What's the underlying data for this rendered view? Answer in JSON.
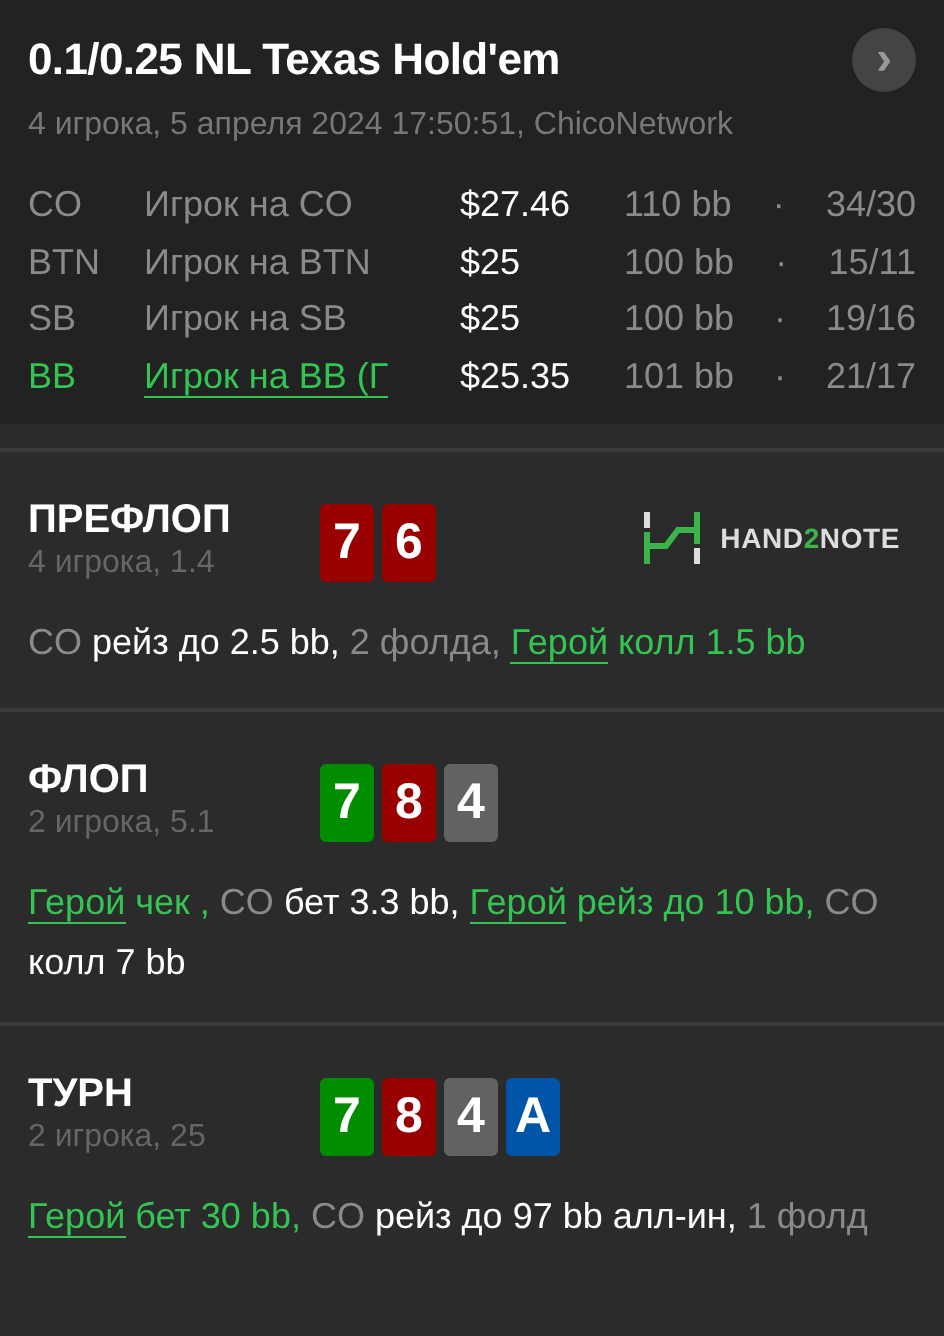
{
  "header": {
    "title": "0.1/0.25 NL Texas Hold'em",
    "subtitle": "4 игрока, 5 апреля 2024 17:50:51, ChicoNetwork",
    "next_button": "›"
  },
  "players": [
    {
      "position": "CO",
      "name": "Игрок на CO",
      "stack": "$27.46",
      "bb": "110 bb",
      "sep": "·",
      "stats": "34/30",
      "hero": false
    },
    {
      "position": "BTN",
      "name": "Игрок на BTN",
      "stack": "$25",
      "bb": "100 bb",
      "sep": "·",
      "stats": "15/11",
      "hero": false
    },
    {
      "position": "SB",
      "name": "Игрок на SB",
      "stack": "$25",
      "bb": "100 bb",
      "sep": "·",
      "stats": "19/16",
      "hero": false
    },
    {
      "position": "BB",
      "name": "Игрок на BB (Г",
      "stack": "$25.35",
      "bb": "101 bb",
      "sep": "·",
      "stats": "21/17",
      "hero": true
    }
  ],
  "streets": [
    {
      "name": "ПРЕФЛОП",
      "info": "4 игрока, 1.4",
      "cards": [
        {
          "rank": "7",
          "color": "#990000"
        },
        {
          "rank": "6",
          "color": "#990000"
        }
      ],
      "logo": [
        "HAND",
        "2",
        "NOTE"
      ],
      "actions": [
        {
          "text": "CO ",
          "kind": "muted"
        },
        {
          "text": "рейз до 2.5 bb,",
          "kind": "plain"
        },
        {
          "text": " 2 фолда, ",
          "kind": "muted"
        },
        {
          "text": "Герой",
          "kind": "link"
        },
        {
          "text": " колл 1.5 bb",
          "kind": "hero"
        }
      ]
    },
    {
      "name": "ФЛОП",
      "info": "2 игрока, 5.1",
      "cards": [
        {
          "rank": "7",
          "color": "#008e00"
        },
        {
          "rank": "8",
          "color": "#990000"
        },
        {
          "rank": "4",
          "color": "#626262"
        }
      ],
      "actions": [
        {
          "text": "Герой",
          "kind": "link"
        },
        {
          "text": " чек ,",
          "kind": "hero"
        },
        {
          "text": " CO ",
          "kind": "muted"
        },
        {
          "text": "бет 3.3 bb, ",
          "kind": "plain"
        },
        {
          "text": "Герой",
          "kind": "link"
        },
        {
          "text": " рейз до 10 bb,",
          "kind": "hero"
        },
        {
          "text": " CO ",
          "kind": "muted"
        },
        {
          "text": "колл 7 bb",
          "kind": "plain"
        }
      ]
    },
    {
      "name": "ТУРН",
      "info": "2 игрока, 25",
      "cards": [
        {
          "rank": "7",
          "color": "#008e00"
        },
        {
          "rank": "8",
          "color": "#990000"
        },
        {
          "rank": "4",
          "color": "#626262"
        },
        {
          "rank": "A",
          "color": "#0055a8"
        }
      ],
      "actions": [
        {
          "text": "Герой",
          "kind": "link"
        },
        {
          "text": " бет 30 bb,",
          "kind": "hero"
        },
        {
          "text": " CO ",
          "kind": "muted"
        },
        {
          "text": "рейз до 97 bb алл-ин,",
          "kind": "plain"
        },
        {
          "text": " 1 фолд",
          "kind": "muted"
        }
      ]
    }
  ]
}
